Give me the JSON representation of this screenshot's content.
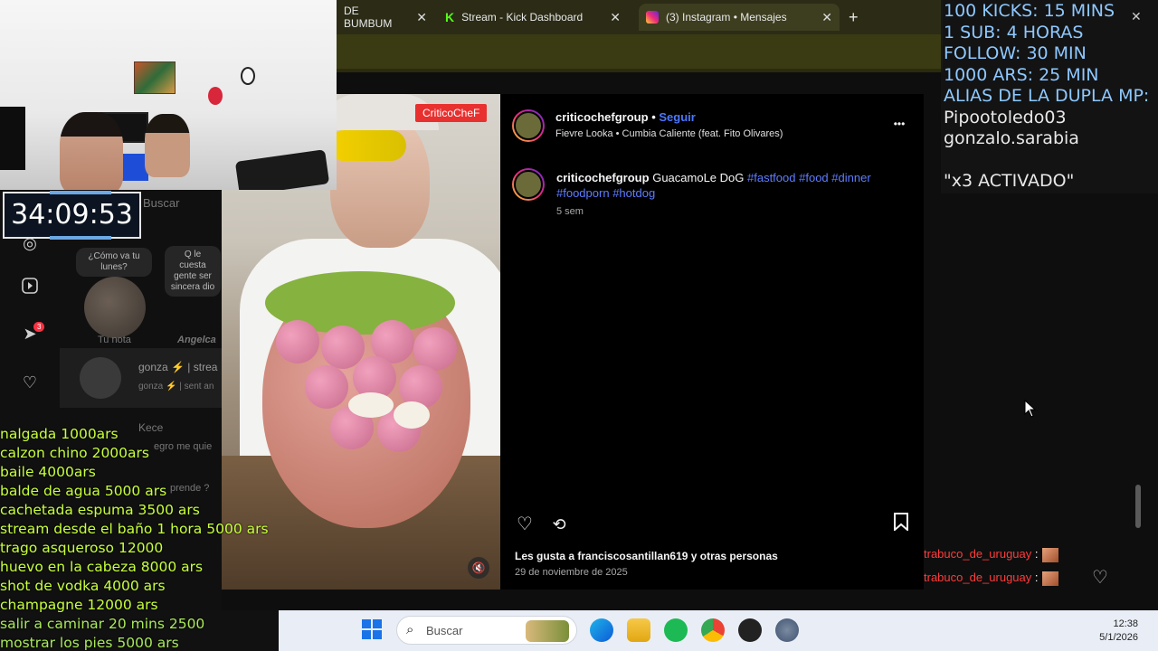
{
  "browser": {
    "tabs": [
      {
        "title": "DE BUMBUM",
        "icon": "audio-icon",
        "active": false
      },
      {
        "title": "Stream - Kick Dashboard",
        "icon": "kick-icon",
        "active": false
      },
      {
        "title": "(3) Instagram • Mensajes",
        "icon": "instagram-icon",
        "active": true
      }
    ],
    "new_tab_label": "+",
    "close_label": "✕"
  },
  "timer": "34:09:53",
  "overlay": {
    "lines": [
      "100 KICKS: 15 MINS",
      "1 SUB: 4 HORAS",
      "FOLLOW: 30 MIN",
      "1000 ARS: 25 MIN",
      "ALIAS DE LA DUPLA MP:",
      "Pipootoledo03",
      "gonzalo.sarabia",
      "",
      "\"x3 ACTIVADO\""
    ]
  },
  "price_list": [
    "nalgada 1000ars",
    "calzon chino 2000ars",
    "baile 4000ars",
    "balde de agua 5000 ars",
    "cachetada espuma 3500 ars",
    "stream desde el baño 1 hora 5000 ars",
    "trago asqueroso 12000",
    "huevo en la cabeza 8000 ars",
    "shot de vodka 4000 ars",
    "champagne 12000 ars",
    "salir a caminar 20 mins 2500",
    "mostrar los pies 5000 ars"
  ],
  "sidebar": {
    "search_placeholder": "Buscar",
    "notes": [
      {
        "bubble": "¿Cómo va tu lunes?",
        "label": "Tu nota"
      },
      {
        "bubble": "Q le cuesta gente ser sincera dio",
        "label": "Angelca"
      }
    ],
    "conversations": [
      {
        "name": "gonza ⚡ | strea",
        "preview": "gonza ⚡ | sent an"
      },
      {
        "name": "Kece",
        "preview": "egro me quie"
      },
      {
        "name": "",
        "preview": "prende ?"
      }
    ],
    "notification_count": "3"
  },
  "post": {
    "username": "criticochefgroup",
    "follow_label": "Seguir",
    "audio": "Fievre Looka • Cumbia Caliente (feat. Fito Olivares)",
    "caption_user": "criticochefgroup",
    "caption_text": "GuacamoLe DoG",
    "hashtags": [
      "#fastfood",
      "#food",
      "#dinner",
      "#foodporn",
      "#hotdog"
    ],
    "time_ago": "5 sem",
    "likes_text": "Les gusta a franciscosantillan619 y otras personas",
    "date": "29 de noviembre de 2025",
    "watermark": "CriticoCheF",
    "more_label": "•••"
  },
  "chat": [
    {
      "user": "trabuco_de_uruguay",
      "sep": " :"
    },
    {
      "user": "trabuco_de_uruguay",
      "sep": " :"
    }
  ],
  "taskbar": {
    "search_label": "Buscar",
    "time": "12:38",
    "date": "5/1/2026"
  }
}
